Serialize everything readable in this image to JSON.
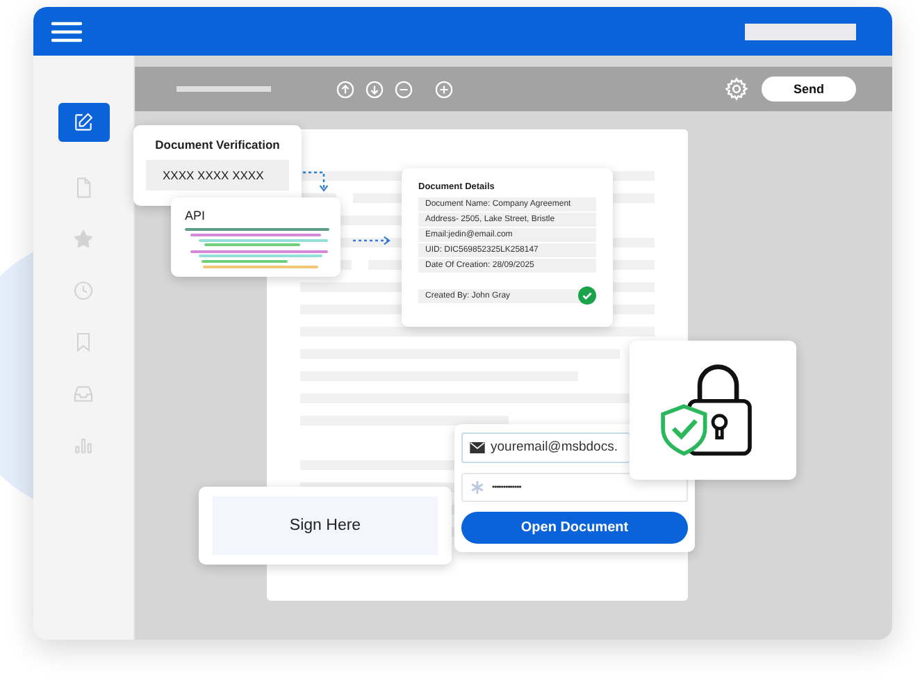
{
  "sidebar": {
    "items": [
      {
        "kind": "edit",
        "selected": true
      },
      {
        "kind": "file",
        "selected": false
      },
      {
        "kind": "star",
        "selected": false
      },
      {
        "kind": "clock",
        "selected": false
      },
      {
        "kind": "bookmark",
        "selected": false
      },
      {
        "kind": "inbox",
        "selected": false
      },
      {
        "kind": "chart",
        "selected": false
      }
    ]
  },
  "toolbar": {
    "send_button": "Send"
  },
  "document_verification": {
    "title": "Document Verification",
    "value": "XXXX XXXX XXXX"
  },
  "api": {
    "title": "API"
  },
  "document_details": {
    "title": "Document Details",
    "rows": [
      "Document Name: Company Agreement",
      "Address- 2505, Lake Street, Bristle",
      "Email:jedin@email.com",
      "UID: DIC569852325LK258147",
      "Date Of Creation: 28/09/2025"
    ],
    "created_by": "Created By: John Gray",
    "verified": true
  },
  "login": {
    "email": "youremail@msbdocs.",
    "password": "•••••••••••••",
    "button": "Open Document"
  },
  "sign_here": {
    "label": "Sign Here"
  }
}
